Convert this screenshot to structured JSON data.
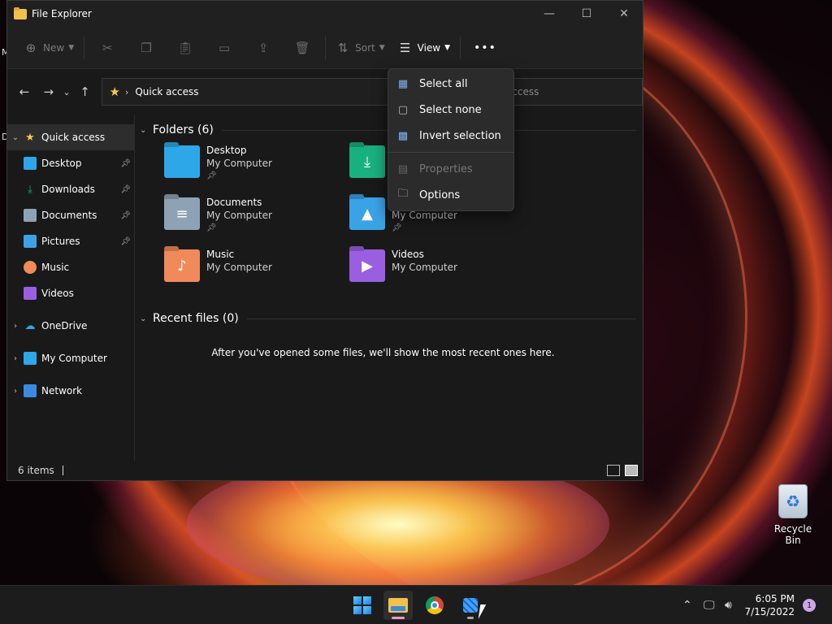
{
  "window": {
    "title": "File Explorer",
    "controls": {
      "minimize": "—",
      "maximize": "☐",
      "close": "✕"
    }
  },
  "toolbar": {
    "new_label": "New",
    "sort_label": "Sort",
    "view_label": "View",
    "more_label": "•••"
  },
  "address": {
    "path": "Quick access",
    "search_placeholder": "Search Quick access"
  },
  "sidebar": {
    "quick_access": "Quick access",
    "items": [
      {
        "label": "Desktop"
      },
      {
        "label": "Downloads"
      },
      {
        "label": "Documents"
      },
      {
        "label": "Pictures"
      },
      {
        "label": "Music"
      },
      {
        "label": "Videos"
      }
    ],
    "onedrive": "OneDrive",
    "my_computer": "My Computer",
    "network": "Network"
  },
  "content": {
    "folders_header": "Folders (6)",
    "folders": [
      {
        "name": "Desktop",
        "location": "My Computer",
        "color": "#2ea7e8"
      },
      {
        "name": "",
        "location": "",
        "color": "#19b07f"
      },
      {
        "name": "Documents",
        "location": "My Computer",
        "color": "#8ea2b5"
      },
      {
        "name": "",
        "location": "My Computer",
        "color": "#3aa3e6"
      },
      {
        "name": "Music",
        "location": "My Computer",
        "color": "#f08a5a"
      },
      {
        "name": "Videos",
        "location": "My Computer",
        "color": "#9a5fe0"
      }
    ],
    "recent_header": "Recent files (0)",
    "empty_message": "After you've opened some files, we'll show the most recent ones here."
  },
  "menu": {
    "items": [
      {
        "label": "Select all"
      },
      {
        "label": "Select none"
      },
      {
        "label": "Invert selection"
      },
      {
        "label": "Properties"
      },
      {
        "label": "Options"
      }
    ]
  },
  "status": {
    "items_count": "6 items"
  },
  "desktop": {
    "recycle_bin": "Recycle Bin",
    "left_edge_a": "M",
    "left_edge_b": "D"
  },
  "taskbar": {
    "time": "6:05 PM",
    "date": "7/15/2022",
    "notification_count": "1"
  }
}
